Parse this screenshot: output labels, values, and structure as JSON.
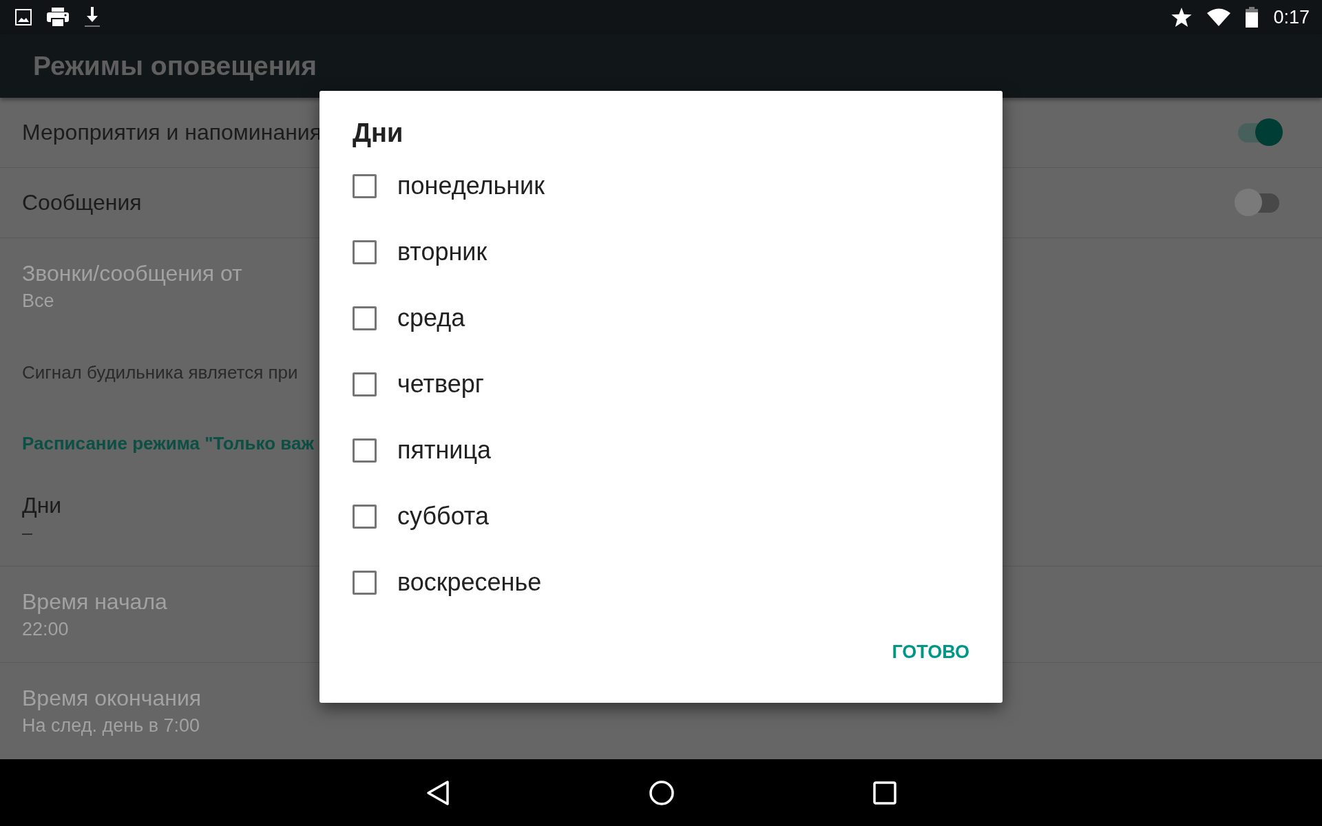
{
  "status_bar": {
    "time": "0:17"
  },
  "app_bar": {
    "title": "Режимы оповещения"
  },
  "settings": [
    {
      "kind": "switch",
      "title": "Мероприятия и напоминания",
      "on": true,
      "divider": true
    },
    {
      "kind": "switch",
      "title": "Сообщения",
      "on": false,
      "divider": true
    },
    {
      "kind": "item",
      "title": "Звонки/сообщения от",
      "summary": "Все",
      "disabled": true,
      "divider": false
    },
    {
      "kind": "text",
      "title": "Сигнал будильника является при",
      "divider": false
    },
    {
      "kind": "header",
      "title": "Расписание режима \"Только важ",
      "divider": false
    },
    {
      "kind": "item",
      "title": "Дни",
      "summary": "–",
      "disabled": false,
      "divider": true
    },
    {
      "kind": "item",
      "title": "Время начала",
      "summary": "22:00",
      "disabled": true,
      "divider": true
    },
    {
      "kind": "item",
      "title": "Время окончания",
      "summary": "На след. день в 7:00",
      "disabled": true,
      "divider": false
    }
  ],
  "dialog": {
    "title": "Дни",
    "options": [
      {
        "label": "понедельник",
        "checked": false
      },
      {
        "label": "вторник",
        "checked": false
      },
      {
        "label": "среда",
        "checked": false
      },
      {
        "label": "четверг",
        "checked": false
      },
      {
        "label": "пятница",
        "checked": false
      },
      {
        "label": "суббота",
        "checked": false
      },
      {
        "label": "воскресенье",
        "checked": false
      }
    ],
    "button": "ГОТОВО"
  }
}
